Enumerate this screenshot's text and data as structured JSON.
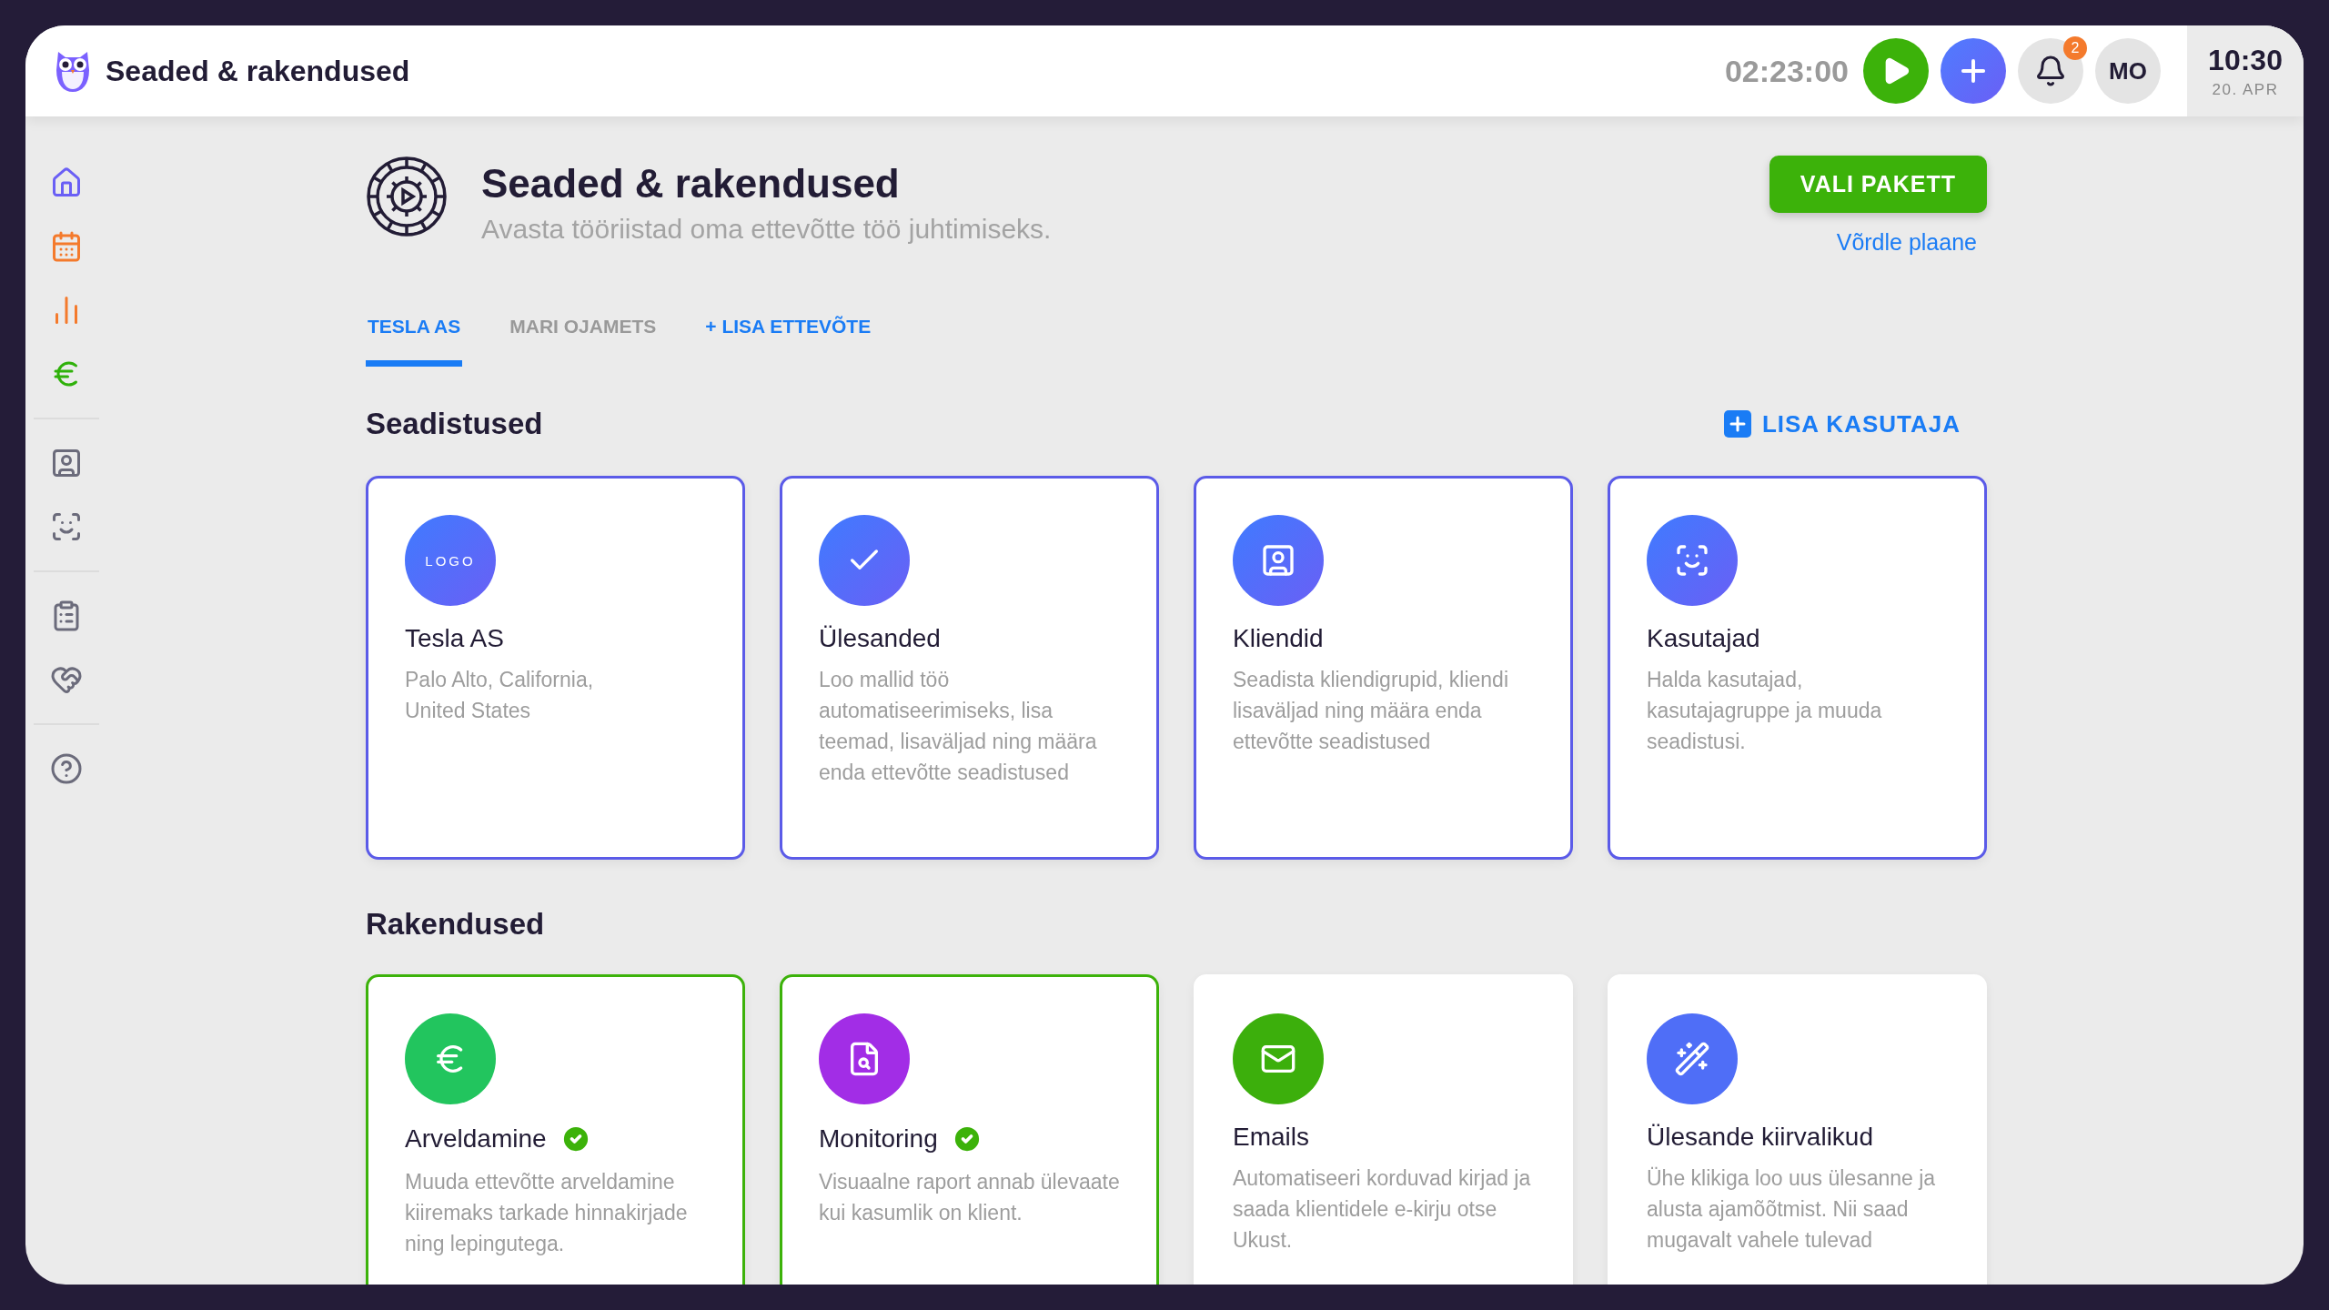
{
  "topbar": {
    "title": "Seaded & rakendused",
    "timer": "02:23:00",
    "notifications": "2",
    "avatar": "MO",
    "time": "10:30",
    "date": "20. APR"
  },
  "header": {
    "title": "Seaded & rakendused",
    "subtitle": "Avasta tööriistad oma ettevõtte töö juhtimiseks.",
    "primary_button": "VALI PAKETT",
    "link": "Võrdle plaane"
  },
  "tabs": [
    {
      "label": "TESLA AS",
      "selected": true
    },
    {
      "label": "MARI OJAMETS",
      "selected": false
    }
  ],
  "add_tab": "+ LISA ETTEVÕTE",
  "settings": {
    "title": "Seadistused",
    "action": "LISA KASUTAJA",
    "cards": [
      {
        "logo": "LOGO",
        "title": "Tesla AS",
        "description": "Palo Alto, California,\nUnited States"
      },
      {
        "title": "Ülesanded",
        "description": "Loo mallid töö automatiseerimiseks, lisa teemad, lisaväljad ning määra enda ettevõtte seadistused"
      },
      {
        "title": "Kliendid",
        "description": "Seadista kliendigrupid, kliendi lisaväljad ning määra enda ettevõtte seadistused"
      },
      {
        "title": "Kasutajad",
        "description": "Halda kasutajad, kasutajagruppe ja muuda seadistusi."
      }
    ]
  },
  "apps": {
    "title": "Rakendused",
    "cards": [
      {
        "title": "Arveldamine",
        "description": "Muuda ettevõtte arveldamine kiiremaks tarkade hinnakirjade ning lepingutega.",
        "color": "#22c55e",
        "enabled": true
      },
      {
        "title": "Monitoring",
        "description": "Visuaalne raport annab ülevaate kui kasumlik on klient.",
        "color": "#a22de6",
        "enabled": true
      },
      {
        "title": "Emails",
        "description": "Automatiseeri korduvad kirjad ja saada klientidele e-kirju otse Ukust.",
        "color": "#3caf0c",
        "enabled": false
      },
      {
        "title": "Ülesande kiirvalikud",
        "description": "Ühe klikiga loo uus ülesanne ja alusta ajamõõtmist. Nii saad mugavalt vahele tulevad",
        "color": "#4f6ef7",
        "enabled": false
      }
    ]
  }
}
